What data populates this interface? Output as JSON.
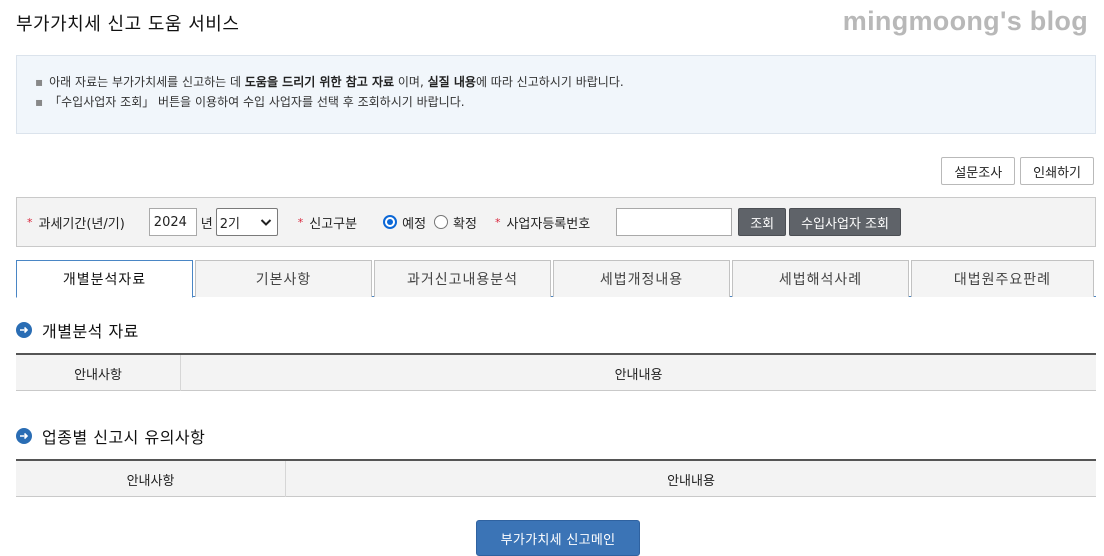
{
  "page": {
    "title": "부가가치세 신고 도움 서비스",
    "watermark": "mingmoong's blog"
  },
  "notice": {
    "line1_prefix": "아래 자료는 부가가치세를 신고하는 데 ",
    "line1_bold1": "도움을 드리기 위한 참고 자료",
    "line1_mid": " 이며, ",
    "line1_bold2": "실질 내용",
    "line1_suffix": "에 따라 신고하시기 바랍니다.",
    "line2": "「수입사업자 조회」 버튼을 이용하여 수입 사업자를 선택 후 조회하시기 바랍니다."
  },
  "actions": {
    "survey_label": "설문조사",
    "print_label": "인쇄하기"
  },
  "search": {
    "period_label": "과세기간(년/기)",
    "year_value": "2024",
    "year_unit": "년",
    "period_selected": "2기",
    "report_type_label": "신고구분",
    "radio_options": [
      {
        "label": "예정",
        "checked": true
      },
      {
        "label": "확정",
        "checked": false
      }
    ],
    "bizno_label": "사업자등록번호",
    "bizno_value": "",
    "search_button": "조회",
    "import_button": "수입사업자 조회",
    "required_mark": "*"
  },
  "tabs": [
    {
      "label": "개별분석자료",
      "active": true
    },
    {
      "label": "기본사항",
      "active": false
    },
    {
      "label": "과거신고내용분석",
      "active": false
    },
    {
      "label": "세법개정내용",
      "active": false
    },
    {
      "label": "세법해석사례",
      "active": false
    },
    {
      "label": "대법원주요판례",
      "active": false
    }
  ],
  "sections": [
    {
      "title": "개별분석 자료",
      "col1": "안내사항",
      "col2": "안내내용"
    },
    {
      "title": "업종별 신고시 유의사항",
      "col1": "안내사항",
      "col2": "안내내용"
    }
  ],
  "footer": {
    "main_button": "부가가치세 신고메인"
  },
  "colors": {
    "accent": "#3b74b6",
    "required": "#d8243b",
    "notice_bg": "#f1f6fb"
  }
}
